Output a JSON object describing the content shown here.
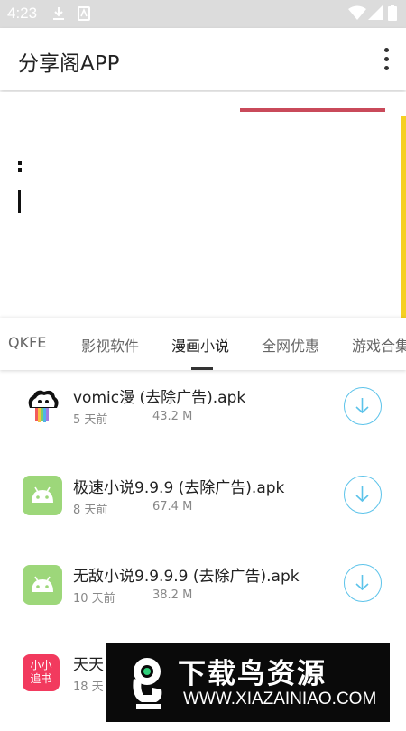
{
  "status_bar": {
    "time": "4:23",
    "icons": [
      "download-icon",
      "app-notification-icon",
      "wifi-icon",
      "signal-icon",
      "battery-icon"
    ]
  },
  "app_bar": {
    "title": "分享阁APP",
    "menu_icon": "more-vert-icon"
  },
  "tabs": {
    "items": [
      {
        "label": "QKFE"
      },
      {
        "label": "影视软件"
      },
      {
        "label": "漫画小说"
      },
      {
        "label": "全网优惠"
      },
      {
        "label": "游戏合集"
      }
    ],
    "active_index": 2
  },
  "files": [
    {
      "name": "vomic漫 (去除广告).apk",
      "date": "5 天前",
      "size": "43.2 M",
      "icon": "vomic-app-icon"
    },
    {
      "name": "极速小说9.9.9 (去除广告).apk",
      "date": "8 天前",
      "size": "67.4 M",
      "icon": "android-icon"
    },
    {
      "name": "无敌小说9.9.9.9 (去除广告).apk",
      "date": "10 天前",
      "size": "38.2 M",
      "icon": "android-icon"
    },
    {
      "name": "天天",
      "date": "18 天",
      "size": "",
      "icon": "xiaoxiao-zhuishu-icon",
      "icon_text": [
        "小小",
        "追书"
      ]
    }
  ],
  "watermark": {
    "title": "下载鸟资源",
    "url": "WWW.XIAZAINIAO.COM"
  },
  "colors": {
    "status_bar": "#dcdcdc",
    "accent_download": "#5cc3ea",
    "android_green": "#9dd77a",
    "banner_red": "#c94a5a",
    "banner_yellow": "#f5d022"
  }
}
